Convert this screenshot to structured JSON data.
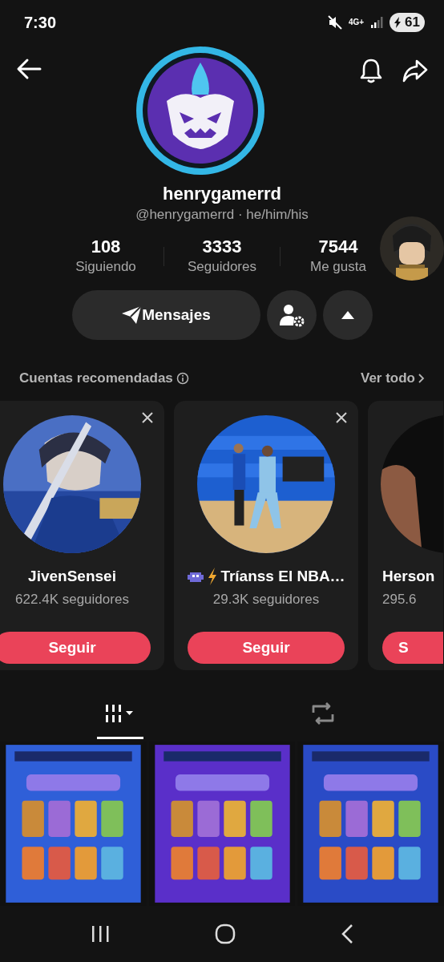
{
  "status_bar": {
    "time": "7:30",
    "network": "4G+",
    "battery": "61"
  },
  "profile": {
    "username": "henrygamerrd",
    "handle": "@henrygamerrd · he/him/his",
    "message_button": "Mensajes",
    "stats": [
      {
        "value": "108",
        "label": "Siguiendo"
      },
      {
        "value": "3333",
        "label": "Seguidores"
      },
      {
        "value": "7544",
        "label": "Me gusta"
      }
    ]
  },
  "recommended": {
    "title": "Cuentas recomendadas",
    "see_all": "Ver todo",
    "accounts": [
      {
        "kind": "full",
        "name": "JivenSensei",
        "followers": "622.4K seguidores",
        "button": "Seguir",
        "name_icons": false
      },
      {
        "kind": "full",
        "name": "Tríanss El NBA…",
        "followers": "29.3K seguidores",
        "button": "Seguir",
        "name_icons": true
      },
      {
        "kind": "cut",
        "name": "Herson",
        "followers": "295.6",
        "button": "S",
        "name_icons": false
      }
    ]
  },
  "tabs": [
    {
      "kind": "grid",
      "selected": true
    },
    {
      "kind": "repost",
      "selected": false
    }
  ]
}
